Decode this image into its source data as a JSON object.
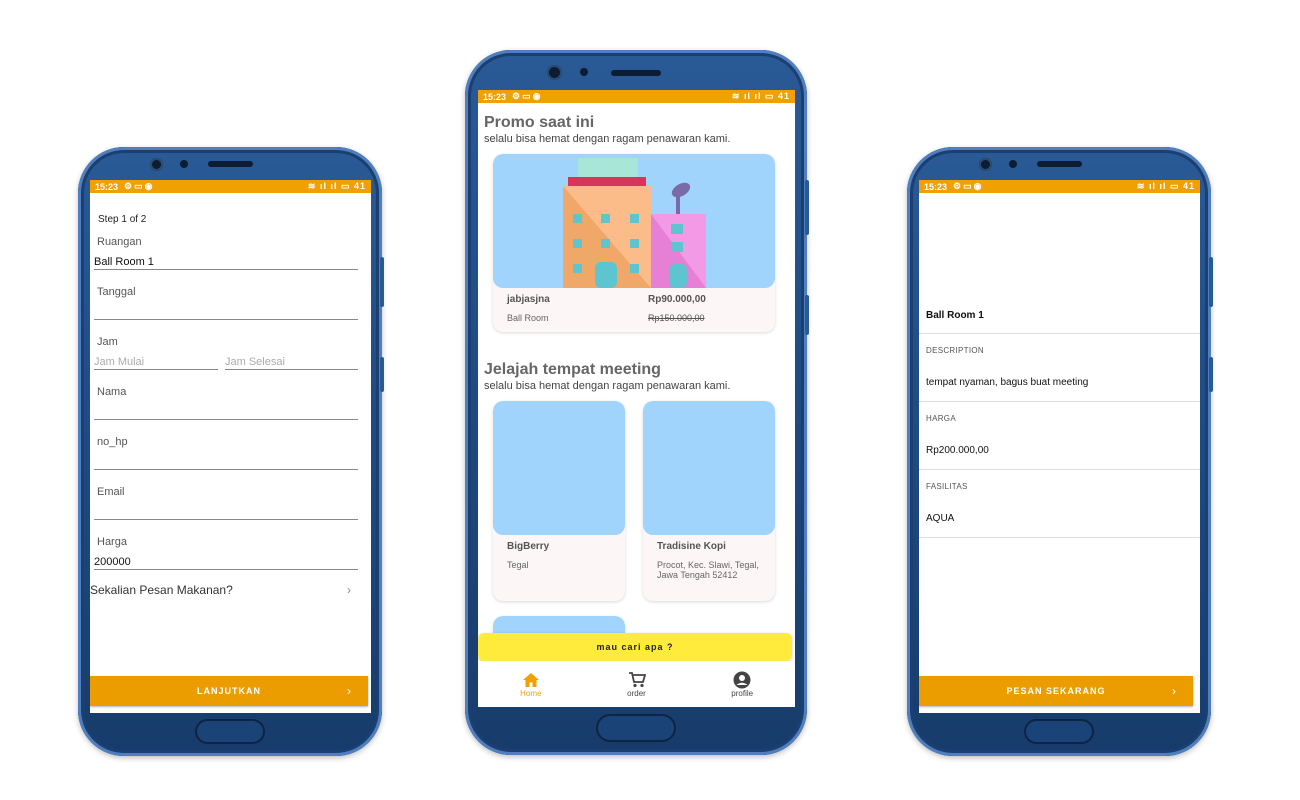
{
  "status_bar": {
    "time": "15:23",
    "battery": "41"
  },
  "booking_form": {
    "step": "Step 1 of 2",
    "ruangan_label": "Ruangan",
    "ruangan_value": "Ball Room 1",
    "tanggal_label": "Tanggal",
    "jam_label": "Jam",
    "jam_mulai_placeholder": "Jam Mulai",
    "jam_selesai_placeholder": "Jam Selesai",
    "nama_label": "Nama",
    "no_hp_label": "no_hp",
    "email_label": "Email",
    "harga_label": "Harga",
    "harga_value": "200000",
    "food_prompt": "Sekalian Pesan Makanan?",
    "continue_button": "LANJUTKAN"
  },
  "home": {
    "promo_title": "Promo saat ini",
    "promo_subtitle": "selalu bisa hemat dengan ragam penawaran kami.",
    "promo_card": {
      "name": "jabjasjna",
      "type": "Ball Room",
      "price": "Rp90.000,00",
      "old_price": "Rp150.000,00"
    },
    "explore_title": "Jelajah tempat meeting",
    "explore_subtitle": "selalu bisa hemat dengan ragam penawaran kami.",
    "venues": [
      {
        "name": "BigBerry",
        "address": "Tegal"
      },
      {
        "name": "Tradisine Kopi",
        "address": "Procot, Kec. Slawi, Tegal, Jawa Tengah 52412"
      }
    ],
    "search_button": "mau cari apa ?",
    "nav": [
      {
        "label": "Home",
        "icon": "home-icon"
      },
      {
        "label": "order",
        "icon": "cart-icon"
      },
      {
        "label": "profile",
        "icon": "account-circle-icon"
      }
    ],
    "accent_color": "#f0a000"
  },
  "room_detail": {
    "title": "Ball Room 1",
    "description_label": "DESCRIPTION",
    "description_value": "tempat nyaman, bagus buat meeting",
    "harga_label": "HARGA",
    "harga_value": "Rp200.000,00",
    "fasilitas_label": "FASILITAS",
    "fasilitas_value": "AQUA",
    "order_button": "PESAN SEKARANG"
  }
}
